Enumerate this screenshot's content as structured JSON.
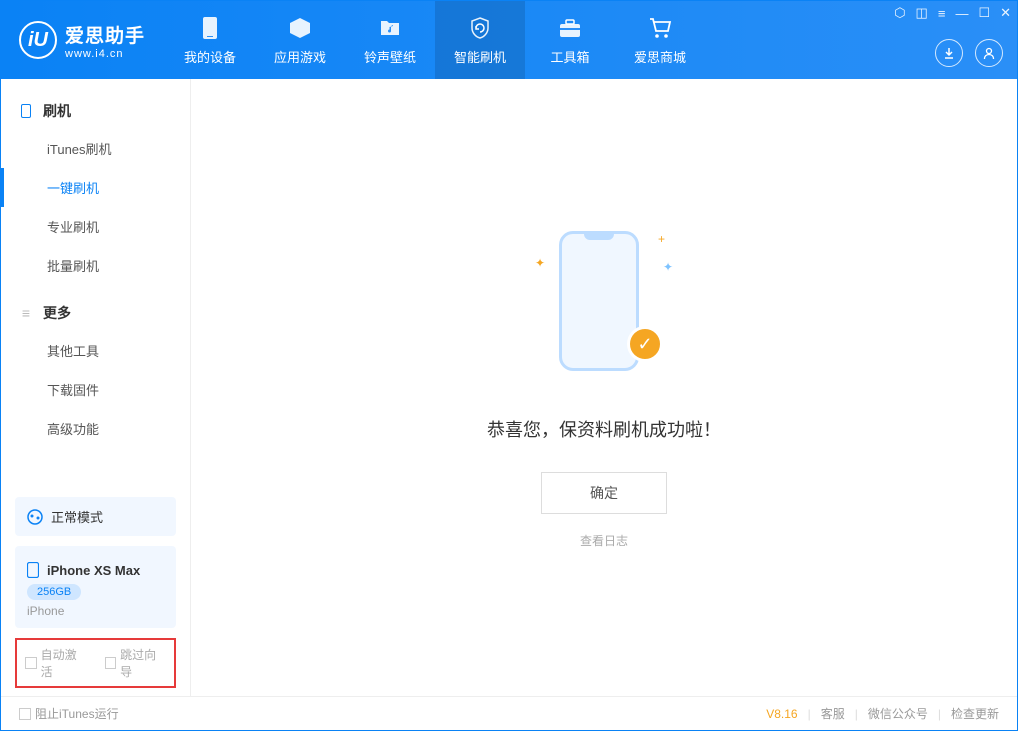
{
  "app": {
    "title": "爱思助手",
    "subtitle": "www.i4.cn"
  },
  "nav": {
    "device": "我的设备",
    "apps": "应用游戏",
    "ringtones": "铃声壁纸",
    "flash": "智能刷机",
    "toolbox": "工具箱",
    "store": "爱思商城"
  },
  "sidebar": {
    "group1_title": "刷机",
    "items1": {
      "itunes": "iTunes刷机",
      "oneclick": "一键刷机",
      "pro": "专业刷机",
      "batch": "批量刷机"
    },
    "group2_title": "更多",
    "items2": {
      "othertools": "其他工具",
      "firmware": "下载固件",
      "advanced": "高级功能"
    },
    "mode": "正常模式",
    "device_name": "iPhone XS Max",
    "storage": "256GB",
    "device_type": "iPhone",
    "auto_activate": "自动激活",
    "skip_guide": "跳过向导"
  },
  "main": {
    "success_text": "恭喜您，保资料刷机成功啦！",
    "ok_button": "确定",
    "view_log": "查看日志"
  },
  "footer": {
    "block_itunes": "阻止iTunes运行",
    "version": "V8.16",
    "support": "客服",
    "wechat": "微信公众号",
    "update": "检查更新"
  }
}
